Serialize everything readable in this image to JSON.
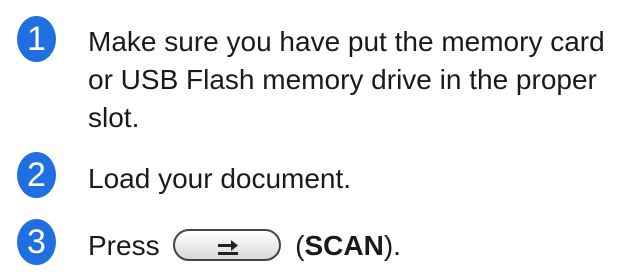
{
  "steps": [
    {
      "number": "1",
      "text": "Make sure you have put the memory card or USB Flash memory drive in the proper slot."
    },
    {
      "number": "2",
      "text": "Load your document."
    },
    {
      "number": "3",
      "prefix": "Press",
      "button_label": "SCAN",
      "open_paren": "(",
      "close_paren": ").",
      "button_icon": "scan-icon"
    }
  ],
  "colors": {
    "badge": "#1f6fe0",
    "text": "#1a1a1a"
  }
}
